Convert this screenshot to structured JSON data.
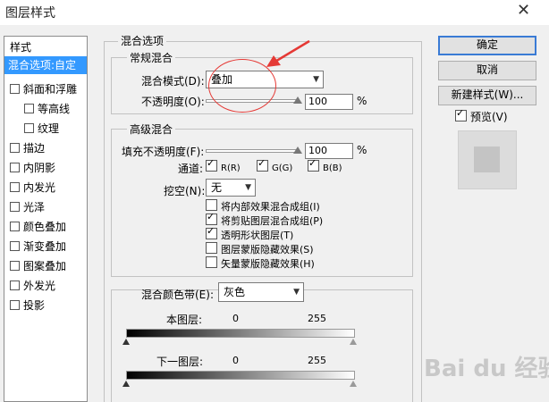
{
  "window": {
    "title": "图层样式",
    "close_glyph": "✕"
  },
  "style_list": {
    "header": "样式",
    "items": [
      {
        "label": "混合选项:自定",
        "selected": true,
        "checkbox": false
      },
      {
        "label": "斜面和浮雕",
        "checkbox": true,
        "checked": false
      },
      {
        "label": "等高线",
        "checkbox": true,
        "checked": false,
        "indent": true
      },
      {
        "label": "纹理",
        "checkbox": true,
        "checked": false,
        "indent": true
      },
      {
        "label": "描边",
        "checkbox": true,
        "checked": false
      },
      {
        "label": "内阴影",
        "checkbox": true,
        "checked": false
      },
      {
        "label": "内发光",
        "checkbox": true,
        "checked": false
      },
      {
        "label": "光泽",
        "checkbox": true,
        "checked": false
      },
      {
        "label": "颜色叠加",
        "checkbox": true,
        "checked": false
      },
      {
        "label": "渐变叠加",
        "checkbox": true,
        "checked": false
      },
      {
        "label": "图案叠加",
        "checkbox": true,
        "checked": false
      },
      {
        "label": "外发光",
        "checkbox": true,
        "checked": false
      },
      {
        "label": "投影",
        "checkbox": true,
        "checked": false
      }
    ]
  },
  "blend_options": {
    "title": "混合选项",
    "general": {
      "title": "常规混合",
      "blend_mode_label": "混合模式(D):",
      "blend_mode_value": "叠加",
      "opacity_label": "不透明度(O):",
      "opacity_value": "100",
      "opacity_unit": "%"
    },
    "advanced": {
      "title": "高级混合",
      "fill_opacity_label": "填充不透明度(F):",
      "fill_opacity_value": "100",
      "fill_unit": "%",
      "channels_label": "通道:",
      "channels": [
        {
          "label": "R(R)",
          "checked": true
        },
        {
          "label": "G(G)",
          "checked": true
        },
        {
          "label": "B(B)",
          "checked": true
        }
      ],
      "knockout_label": "挖空(N):",
      "knockout_value": "无",
      "options": [
        {
          "label": "将内部效果混合成组(I)",
          "checked": false
        },
        {
          "label": "将剪贴图层混合成组(P)",
          "checked": true
        },
        {
          "label": "透明形状图层(T)",
          "checked": true
        },
        {
          "label": "图层蒙版隐藏效果(S)",
          "checked": false
        },
        {
          "label": "矢量蒙版隐藏效果(H)",
          "checked": false
        }
      ]
    },
    "blend_if": {
      "label": "混合颜色带(E):",
      "value": "灰色",
      "this_layer_label": "本图层:",
      "this_layer_min": "0",
      "this_layer_max": "255",
      "underlying_label": "下一图层:",
      "underlying_min": "0",
      "underlying_max": "255"
    }
  },
  "buttons": {
    "ok": "确定",
    "cancel": "取消",
    "new_style": "新建样式(W)...",
    "preview_label": "预览(V)",
    "preview_checked": true
  },
  "colors": {
    "selection": "#3399ff",
    "annotation": "#e53935",
    "default_button_border": "#3a7bd5"
  },
  "watermark": "Bai du 经验"
}
